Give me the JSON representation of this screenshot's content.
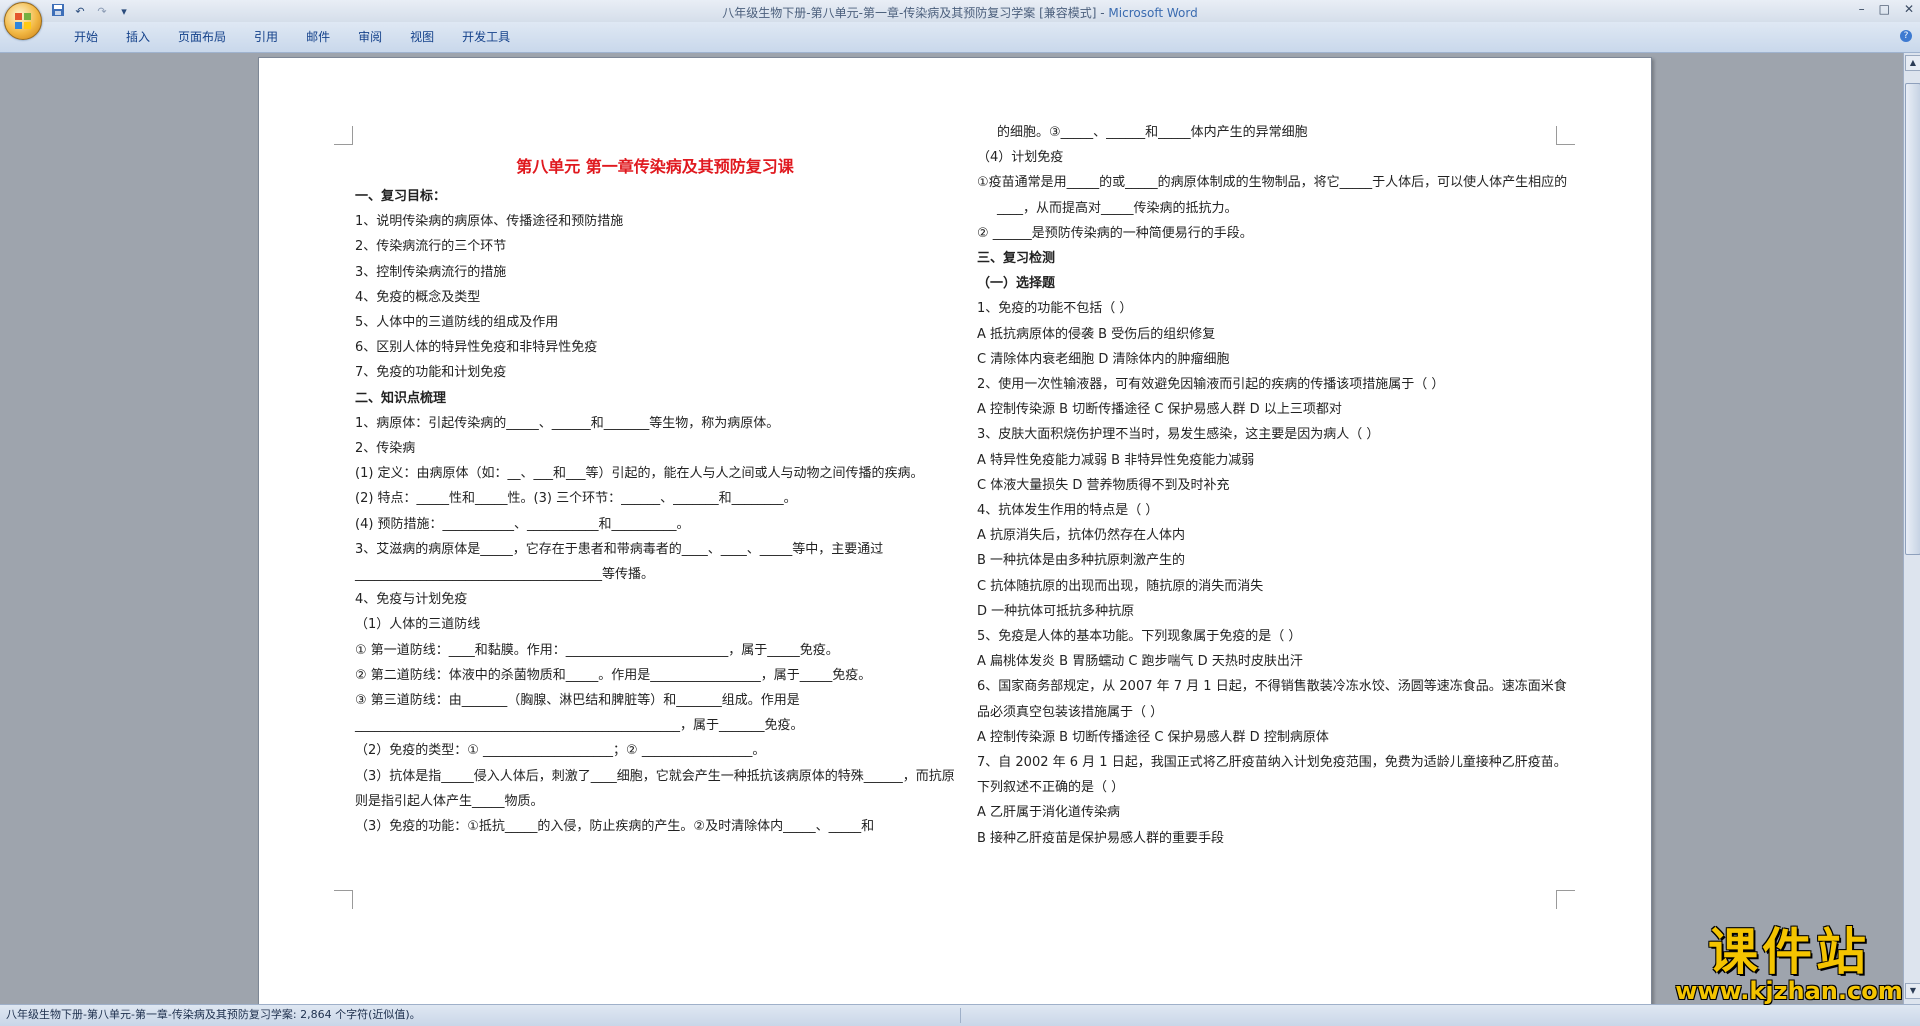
{
  "window": {
    "title_doc": "八年级生物下册-第八单元-第一章-传染病及其预防复习学案 [兼容模式]",
    "title_sep": " - ",
    "title_app": "Microsoft Word",
    "qat": {
      "save_icon": "save-icon",
      "undo_icon": "undo-icon",
      "redo_icon": "redo-icon",
      "more_icon": "customize-icon"
    }
  },
  "ribbon": {
    "tabs": [
      "开始",
      "插入",
      "页面布局",
      "引用",
      "邮件",
      "审阅",
      "视图",
      "开发工具"
    ]
  },
  "document": {
    "title": "第八单元    第一章传染病及其预防复习课",
    "left_column": [
      "一、复习目标：",
      "1、说明传染病的病原体、传播途径和预防措施",
      "2、传染病流行的三个环节",
      "3、控制传染病流行的措施",
      "4、免疫的概念及类型",
      "5、人体中的三道防线的组成及作用",
      "6、区别人体的特异性免疫和非特异性免疫",
      "7、免疫的功能和计划免疫",
      "二、知识点梳理",
      "1、病原体：引起传染病的_____、______和_______等生物，称为病原体。",
      "2、传染病",
      "(1) 定义：由病原体（如：__、___和___等）引起的，能在人与人之间或人与动物之间传播的疾病。",
      "(2) 特点：_____性和_____性。(3) 三个环节：______、_______和________。",
      "(4) 预防措施：___________、___________和__________。",
      "3、艾滋病的病原体是_____，它存在于患者和带病毒者的____、____、_____等中，主要通过______________________________________等传播。",
      "4、免疫与计划免疫",
      "（1）人体的三道防线",
      "① 第一道防线：____和黏膜。作用：_________________________，属于_____免疫。",
      "② 第二道防线：体液中的杀菌物质和_____。作用是_________________，属于_____免疫。",
      "③ 第三道防线：由_______（胸腺、淋巴结和脾脏等）和_______组成。作用是__________________________________________________，属于_______免疫。",
      "（2）免疫的类型：① ____________________；② _________________。",
      "（3）抗体是指_____侵入人体后，刺激了____细胞，它就会产生一种抵抗该病原体的特殊______，而抗原则是指引起人体产生_____物质。",
      "（3）免疫的功能：①抵抗_____的入侵，防止疾病的产生。②及时清除体内_____、_____和"
    ],
    "right_column": [
      "的细胞。③_____、______和_____体内产生的异常细胞",
      "（4）计划免疫",
      "①疫苗通常是用_____的或_____的病原体制成的生物制品，将它_____于人体后，可以使人体产生相应的____，从而提高对_____传染病的抵抗力。",
      "② ______是预防传染病的一种简便易行的手段。",
      "三、复习检测",
      "（一）选择题",
      "1、免疫的功能不包括（    ）",
      "A 抵抗病原体的侵袭  B 受伤后的组织修复",
      "C 清除体内衰老细胞  D 清除体内的肿瘤细胞",
      "2、使用一次性输液器，可有效避免因输液而引起的疾病的传播该项措施属于（  ）",
      "A 控制传染源  B 切断传播途径    C 保护易感人群      D 以上三项都对",
      "3、皮肤大面积烧伤护理不当时，易发生感染，这主要是因为病人（    ）",
      "A 特异性免疫能力减弱    B 非特异性免疫能力减弱",
      "C 体液大量损失          D 营养物质得不到及时补充",
      "4、抗体发生作用的特点是（    ）",
      "A 抗原消失后，抗体仍然存在人体内",
      "B 一种抗体是由多种抗原刺激产生的",
      "C 抗体随抗原的出现而出现，随抗原的消失而消失",
      "D 一种抗体可抵抗多种抗原",
      "5、免疫是人体的基本功能。下列现象属于免疫的是（   ）",
      "A 扁桃体发炎   B 胃肠蠕动   C 跑步喘气   D 天热时皮肤出汗",
      "6、国家商务部规定，从 2007 年 7 月 1 日起，不得销售散装冷冻水饺、汤圆等速冻食品。速冻面米食品必须真空包装该措施属于（    ）",
      "A 控制传染源     B 切断传播途径      C 保护易感人群      D 控制病原体",
      "7、自 2002 年 6 月 1 日起，我国正式将乙肝疫苗纳入计划免疫范围，免费为适龄儿童接种乙肝疫苗。下列叙述不正确的是（    ）",
      "A 乙肝属于消化道传染病",
      "B 接种乙肝疫苗是保护易感人群的重要手段"
    ]
  },
  "status_bar": {
    "text": "八年级生物下册-第八单元-第一章-传染病及其预防复习学案: 2,864 个字符(近似值)。"
  },
  "watermark": {
    "main": "课件站",
    "url": "www.kjzhan.com"
  },
  "colors": {
    "title_red": "#e0191f",
    "ribbon_bg": "#c9d8eb",
    "workspace": "#9ea4ad",
    "watermark_yellow": "#f4c400"
  }
}
